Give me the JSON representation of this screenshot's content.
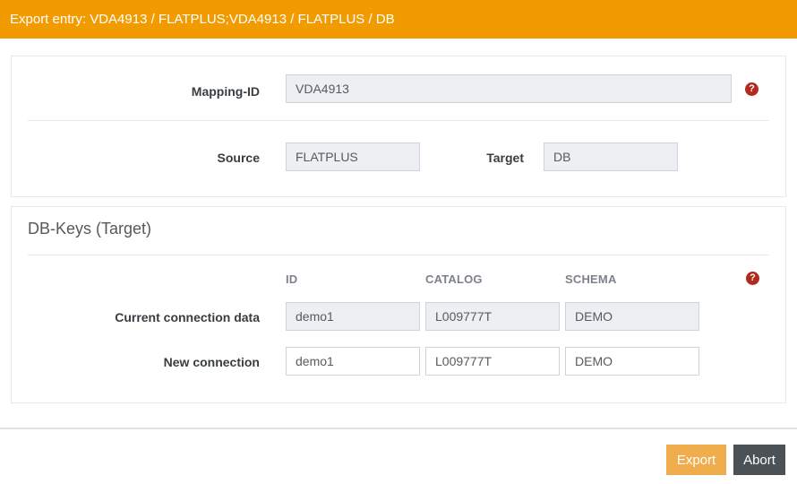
{
  "header": {
    "title": "Export entry: VDA4913 / FLATPLUS;VDA4913 / FLATPLUS / DB"
  },
  "mapping_panel": {
    "mapping_id": {
      "label": "Mapping-ID",
      "value": "VDA4913"
    },
    "source": {
      "label": "Source",
      "value": "FLATPLUS"
    },
    "target": {
      "label": "Target",
      "value": "DB"
    },
    "help_icon": {
      "name": "question-circle-icon",
      "glyph": "?"
    }
  },
  "db_keys": {
    "heading": "DB-Keys (Target)",
    "columns": {
      "id": "ID",
      "catalog": "CATALOG",
      "schema": "SCHEMA"
    },
    "help_icon": {
      "name": "question-circle-icon",
      "glyph": "?"
    },
    "rows": [
      {
        "label": "Current connection data",
        "readonly": true,
        "values": [
          "demo1",
          "L009777T",
          "DEMO"
        ]
      },
      {
        "label": "New connection",
        "readonly": false,
        "values": [
          "demo1",
          "L009777T",
          "DEMO"
        ]
      }
    ]
  },
  "footer": {
    "export_label": "Export",
    "abort_label": "Abort"
  },
  "colors": {
    "header_bg": "#f29b00",
    "export_bg": "#f0ad4e",
    "abort_bg": "#4b5257",
    "help_icon": "#b12a1e",
    "readonly_bg": "#edeff2",
    "input_border": "#ccd3da"
  }
}
